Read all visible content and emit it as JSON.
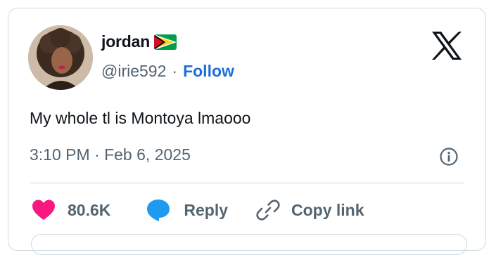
{
  "post": {
    "author": {
      "name": "jordan",
      "handle": "@irie592",
      "follow_label": "Follow",
      "flag_icon": "guyana-flag-icon"
    },
    "text": "My whole tl is Montoya lmaooo",
    "timestamp": "3:10 PM · Feb 6, 2025",
    "separator": "·"
  },
  "actions": {
    "like_count": "80.6K",
    "reply_label": "Reply",
    "copy_link_label": "Copy link"
  },
  "colors": {
    "accent": "#1d6fd8",
    "like": "#f91880",
    "reply": "#1d9bf0",
    "muted": "#536471",
    "border": "#cfd9de"
  },
  "icons": [
    "x-logo-icon",
    "info-icon",
    "heart-icon",
    "reply-bubble-icon",
    "link-icon",
    "guyana-flag-icon"
  ]
}
